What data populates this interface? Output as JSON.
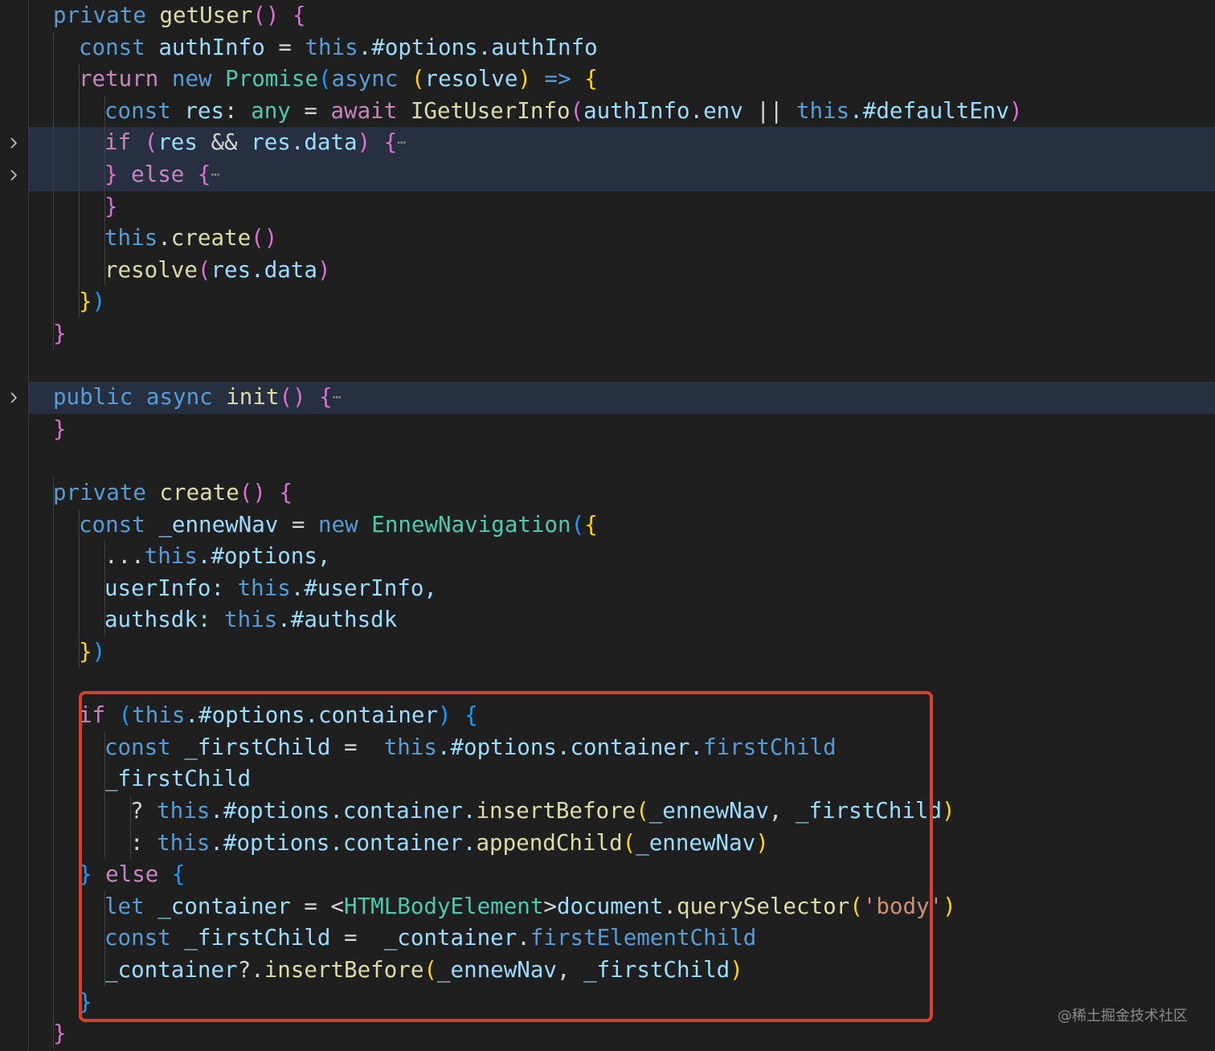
{
  "watermark": "@稀土掘金技术社区",
  "lines": [
    {
      "y": 0,
      "indent": 1,
      "fold": false,
      "hl": false,
      "tokens": [
        [
          "private ",
          "kw"
        ],
        [
          "getUser",
          "fn"
        ],
        [
          "()",
          "p"
        ],
        [
          " ",
          ""
        ],
        [
          "{",
          "p"
        ]
      ]
    },
    {
      "y": 1,
      "indent": 2,
      "fold": false,
      "hl": false,
      "tokens": [
        [
          "const ",
          "kw"
        ],
        [
          "authInfo",
          "var"
        ],
        [
          " = ",
          "pl"
        ],
        [
          "this",
          "kw"
        ],
        [
          ".#options.authInfo",
          "var"
        ]
      ]
    },
    {
      "y": 2,
      "indent": 2,
      "fold": false,
      "hl": false,
      "tokens": [
        [
          "return ",
          "ctl"
        ],
        [
          "new ",
          "kw"
        ],
        [
          "Promise",
          "ty"
        ],
        [
          "(",
          "b"
        ],
        [
          "async ",
          "kw"
        ],
        [
          "(",
          "y"
        ],
        [
          "resolve",
          "var"
        ],
        [
          ")",
          "y"
        ],
        [
          " => ",
          "kw"
        ],
        [
          "{",
          "y"
        ]
      ]
    },
    {
      "y": 3,
      "indent": 3,
      "fold": false,
      "hl": false,
      "tokens": [
        [
          "const ",
          "kw"
        ],
        [
          "res",
          "var"
        ],
        [
          ": ",
          "pl"
        ],
        [
          "any",
          "ty"
        ],
        [
          " = ",
          "pl"
        ],
        [
          "await ",
          "ctl"
        ],
        [
          "IGetUserInfo",
          "fn"
        ],
        [
          "(",
          "p"
        ],
        [
          "authInfo",
          "var"
        ],
        [
          ".env ",
          "var"
        ],
        [
          "|| ",
          "pl"
        ],
        [
          "this",
          "kw"
        ],
        [
          ".#defaultEnv",
          "var"
        ],
        [
          ")",
          "p"
        ]
      ]
    },
    {
      "y": 4,
      "indent": 3,
      "fold": true,
      "hl": true,
      "tokens": [
        [
          "if ",
          "ctl"
        ],
        [
          "(",
          "p"
        ],
        [
          "res ",
          "var"
        ],
        [
          "&& ",
          "pl"
        ],
        [
          "res",
          "var"
        ],
        [
          ".data",
          "var"
        ],
        [
          ") ",
          "p"
        ],
        [
          "{",
          "p"
        ]
      ],
      "ellipsis": true
    },
    {
      "y": 5,
      "indent": 3,
      "fold": true,
      "hl": true,
      "tokens": [
        [
          "} ",
          "p"
        ],
        [
          "else ",
          "ctl"
        ],
        [
          "{",
          "p"
        ]
      ],
      "ellipsis": true
    },
    {
      "y": 6,
      "indent": 3,
      "fold": false,
      "hl": false,
      "tokens": [
        [
          "}",
          "p"
        ]
      ]
    },
    {
      "y": 7,
      "indent": 3,
      "fold": false,
      "hl": false,
      "tokens": [
        [
          "this",
          "kw"
        ],
        [
          ".",
          "pl"
        ],
        [
          "create",
          "fn"
        ],
        [
          "()",
          "p"
        ]
      ]
    },
    {
      "y": 8,
      "indent": 3,
      "fold": false,
      "hl": false,
      "tokens": [
        [
          "resolve",
          "fn"
        ],
        [
          "(",
          "p"
        ],
        [
          "res",
          "var"
        ],
        [
          ".data",
          "var"
        ],
        [
          ")",
          "p"
        ]
      ]
    },
    {
      "y": 9,
      "indent": 2,
      "fold": false,
      "hl": false,
      "tokens": [
        [
          "}",
          "y"
        ],
        [
          ")",
          "b"
        ]
      ]
    },
    {
      "y": 10,
      "indent": 1,
      "fold": false,
      "hl": false,
      "tokens": [
        [
          "}",
          "p"
        ]
      ]
    },
    {
      "y": 12,
      "indent": 1,
      "fold": true,
      "hl": true,
      "tokens": [
        [
          "public ",
          "kw"
        ],
        [
          "async ",
          "kw"
        ],
        [
          "init",
          "fn"
        ],
        [
          "() ",
          "p"
        ],
        [
          "{",
          "p"
        ]
      ],
      "ellipsis": true
    },
    {
      "y": 13,
      "indent": 1,
      "fold": false,
      "hl": false,
      "tokens": [
        [
          "}",
          "p"
        ]
      ]
    },
    {
      "y": 15,
      "indent": 1,
      "fold": false,
      "hl": false,
      "tokens": [
        [
          "private ",
          "kw"
        ],
        [
          "create",
          "fn"
        ],
        [
          "()",
          "p"
        ],
        [
          " ",
          ""
        ],
        [
          "{",
          "p"
        ]
      ]
    },
    {
      "y": 16,
      "indent": 2,
      "fold": false,
      "hl": false,
      "tokens": [
        [
          "const ",
          "kw"
        ],
        [
          "_ennewNav",
          "var"
        ],
        [
          " = ",
          "pl"
        ],
        [
          "new ",
          "kw"
        ],
        [
          "EnnewNavigation",
          "ty"
        ],
        [
          "(",
          "b"
        ],
        [
          "{",
          "y"
        ]
      ]
    },
    {
      "y": 17,
      "indent": 3,
      "fold": false,
      "hl": false,
      "tokens": [
        [
          "...",
          "pl"
        ],
        [
          "this",
          "kw"
        ],
        [
          ".#options,",
          "var"
        ]
      ]
    },
    {
      "y": 18,
      "indent": 3,
      "fold": false,
      "hl": false,
      "tokens": [
        [
          "userInfo: ",
          "var"
        ],
        [
          "this",
          "kw"
        ],
        [
          ".#userInfo,",
          "var"
        ]
      ]
    },
    {
      "y": 19,
      "indent": 3,
      "fold": false,
      "hl": false,
      "tokens": [
        [
          "authsdk: ",
          "var"
        ],
        [
          "this",
          "kw"
        ],
        [
          ".#authsdk",
          "var"
        ]
      ]
    },
    {
      "y": 20,
      "indent": 2,
      "fold": false,
      "hl": false,
      "tokens": [
        [
          "}",
          "y"
        ],
        [
          ")",
          "b"
        ]
      ]
    },
    {
      "y": 22,
      "indent": 2,
      "fold": false,
      "hl": false,
      "tokens": [
        [
          "if ",
          "ctl"
        ],
        [
          "(",
          "b"
        ],
        [
          "this",
          "kw"
        ],
        [
          ".#options.container",
          "var"
        ],
        [
          ") ",
          "b"
        ],
        [
          "{",
          "b"
        ]
      ]
    },
    {
      "y": 23,
      "indent": 3,
      "fold": false,
      "hl": false,
      "tokens": [
        [
          "const ",
          "kw"
        ],
        [
          "_firstChild",
          "var"
        ],
        [
          " =  ",
          "pl"
        ],
        [
          "this",
          "kw"
        ],
        [
          ".#options.container.",
          "var"
        ],
        [
          "firstChild",
          "kw"
        ]
      ]
    },
    {
      "y": 24,
      "indent": 3,
      "fold": false,
      "hl": false,
      "tokens": [
        [
          "_firstChild",
          "var"
        ]
      ]
    },
    {
      "y": 25,
      "indent": 4,
      "fold": false,
      "hl": false,
      "tokens": [
        [
          "? ",
          "pl"
        ],
        [
          "this",
          "kw"
        ],
        [
          ".#options.container.",
          "var"
        ],
        [
          "insertBefore",
          "fn"
        ],
        [
          "(",
          "y"
        ],
        [
          "_ennewNav",
          "var"
        ],
        [
          ", ",
          "pl"
        ],
        [
          "_firstChild",
          "var"
        ],
        [
          ")",
          "y"
        ]
      ]
    },
    {
      "y": 26,
      "indent": 4,
      "fold": false,
      "hl": false,
      "tokens": [
        [
          ": ",
          "pl"
        ],
        [
          "this",
          "kw"
        ],
        [
          ".#options.container.",
          "var"
        ],
        [
          "appendChild",
          "fn"
        ],
        [
          "(",
          "y"
        ],
        [
          "_ennewNav",
          "var"
        ],
        [
          ")",
          "y"
        ]
      ]
    },
    {
      "y": 27,
      "indent": 2,
      "fold": false,
      "hl": false,
      "tokens": [
        [
          "} ",
          "b"
        ],
        [
          "else ",
          "ctl"
        ],
        [
          "{",
          "b"
        ]
      ]
    },
    {
      "y": 28,
      "indent": 3,
      "fold": false,
      "hl": false,
      "tokens": [
        [
          "let ",
          "kw"
        ],
        [
          "_container",
          "var"
        ],
        [
          " = <",
          "pl"
        ],
        [
          "HTMLBodyElement",
          "ty"
        ],
        [
          ">",
          "pl"
        ],
        [
          "document",
          "var"
        ],
        [
          ".",
          "pl"
        ],
        [
          "querySelector",
          "fn"
        ],
        [
          "(",
          "y"
        ],
        [
          "'body'",
          "str"
        ],
        [
          ")",
          "y"
        ]
      ]
    },
    {
      "y": 29,
      "indent": 3,
      "fold": false,
      "hl": false,
      "tokens": [
        [
          "const ",
          "kw"
        ],
        [
          "_firstChild",
          "var"
        ],
        [
          " =  ",
          "pl"
        ],
        [
          "_container",
          "var"
        ],
        [
          ".",
          "pl"
        ],
        [
          "firstElementChild",
          "kw"
        ]
      ]
    },
    {
      "y": 30,
      "indent": 3,
      "fold": false,
      "hl": false,
      "tokens": [
        [
          "_container",
          "var"
        ],
        [
          "?.",
          "pl"
        ],
        [
          "insertBefore",
          "fn"
        ],
        [
          "(",
          "y"
        ],
        [
          "_ennewNav",
          "var"
        ],
        [
          ", ",
          "pl"
        ],
        [
          "_firstChild",
          "var"
        ],
        [
          ")",
          "y"
        ]
      ]
    },
    {
      "y": 31,
      "indent": 2,
      "fold": false,
      "hl": false,
      "tokens": [
        [
          "}",
          "b"
        ]
      ]
    },
    {
      "y": 32,
      "indent": 1,
      "fold": false,
      "hl": false,
      "tokens": [
        [
          "}",
          "p"
        ]
      ]
    }
  ]
}
